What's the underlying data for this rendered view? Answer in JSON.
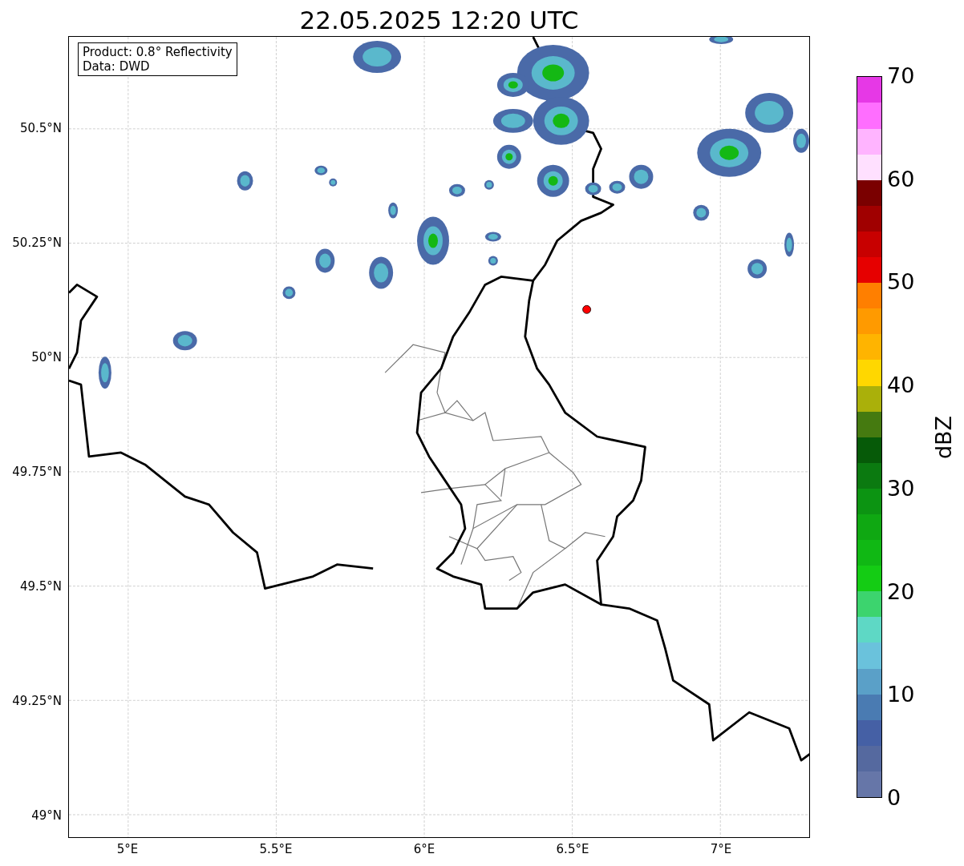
{
  "title": "22.05.2025 12:20 UTC",
  "info_box": [
    "Product: 0.8° Reflectivity",
    "Data: DWD"
  ],
  "y_ticks": [
    "50.5°N",
    "50.25°N",
    "50°N",
    "49.75°N",
    "49.5°N",
    "49.25°N",
    "49°N"
  ],
  "x_ticks": [
    "5°E",
    "5.5°E",
    "6°E",
    "6.5°E",
    "7°E"
  ],
  "colorbar": {
    "label": "dBZ",
    "ticks": [
      "70",
      "60",
      "50",
      "40",
      "30",
      "20",
      "10",
      "0"
    ],
    "segments": [
      {
        "color": "#6676a8"
      },
      {
        "color": "#55699f"
      },
      {
        "color": "#4560a5"
      },
      {
        "color": "#4a7bb2"
      },
      {
        "color": "#5aa0c8"
      },
      {
        "color": "#6ac2dc"
      },
      {
        "color": "#5ed8c5"
      },
      {
        "color": "#3cd46e"
      },
      {
        "color": "#14cc14"
      },
      {
        "color": "#10b814"
      },
      {
        "color": "#0fa812"
      },
      {
        "color": "#0c9412"
      },
      {
        "color": "#0b7a10"
      },
      {
        "color": "#065a08"
      },
      {
        "color": "#457a10"
      },
      {
        "color": "#aab00a"
      },
      {
        "color": "#ffd700"
      },
      {
        "color": "#ffb400"
      },
      {
        "color": "#ff9a00"
      },
      {
        "color": "#ff7f00"
      },
      {
        "color": "#e60000"
      },
      {
        "color": "#c80000"
      },
      {
        "color": "#a00000"
      },
      {
        "color": "#7a0000"
      },
      {
        "color": "#ffe0ff"
      },
      {
        "color": "#ffb4ff"
      },
      {
        "color": "#ff6eff"
      },
      {
        "color": "#e638e6"
      }
    ]
  }
}
